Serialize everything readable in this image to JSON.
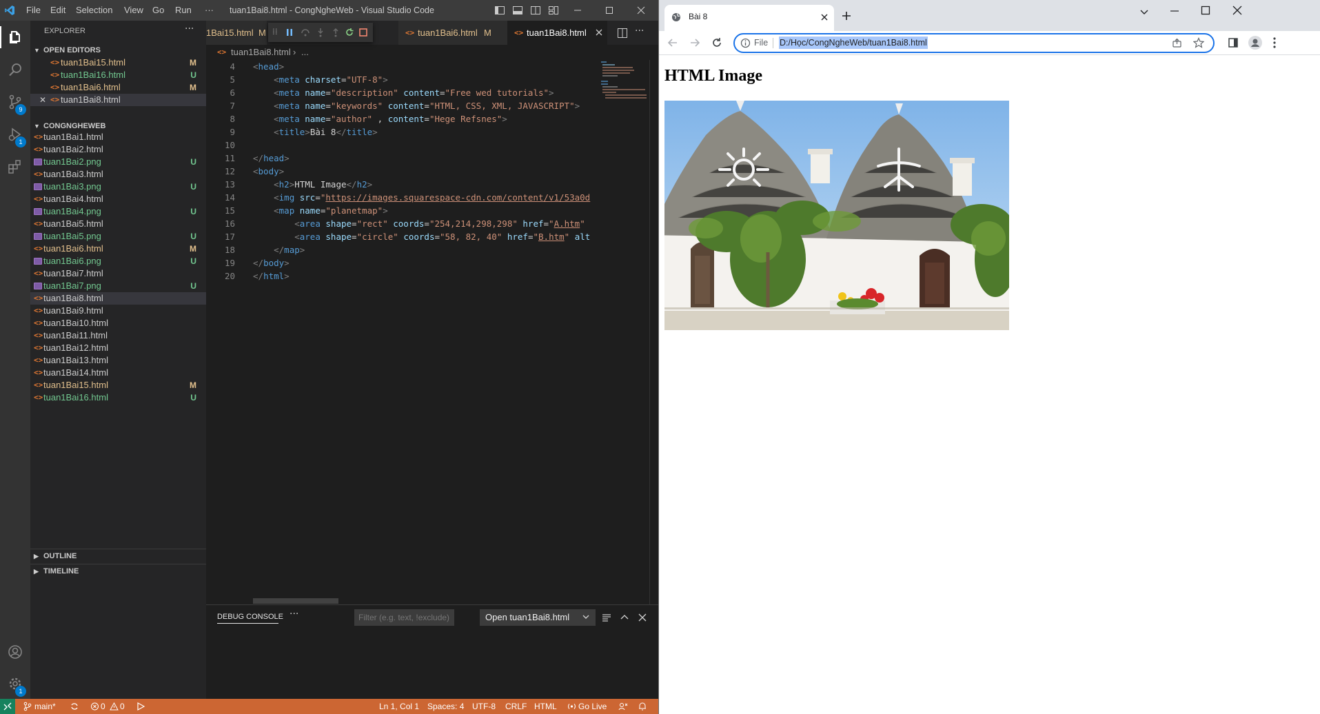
{
  "vscode": {
    "menu": [
      "File",
      "Edit",
      "Selection",
      "View",
      "Go",
      "Run",
      "···"
    ],
    "window_title": "tuan1Bai8.html - CongNgheWeb - Visual Studio Code",
    "badges": {
      "source_control": "9",
      "run_debug": "1",
      "settings": "1"
    },
    "explorer": {
      "title": "EXPLORER",
      "open_editors_label": "OPEN EDITORS",
      "open_editors": [
        {
          "name": "tuan1Bai15.html",
          "status": "M"
        },
        {
          "name": "tuan1Bai16.html",
          "status": "U"
        },
        {
          "name": "tuan1Bai6.html",
          "status": "M"
        },
        {
          "name": "tuan1Bai8.html",
          "status": ""
        }
      ],
      "folder_label": "CONGNGHEWEB",
      "files": [
        {
          "name": "tuan1Bai1.html",
          "type": "html",
          "status": ""
        },
        {
          "name": "tuan1Bai2.html",
          "type": "html",
          "status": ""
        },
        {
          "name": "tuan1Bai2.png",
          "type": "png",
          "status": "U"
        },
        {
          "name": "tuan1Bai3.html",
          "type": "html",
          "status": ""
        },
        {
          "name": "tuan1Bai3.png",
          "type": "png",
          "status": "U"
        },
        {
          "name": "tuan1Bai4.html",
          "type": "html",
          "status": ""
        },
        {
          "name": "tuan1Bai4.png",
          "type": "png",
          "status": "U"
        },
        {
          "name": "tuan1Bai5.html",
          "type": "html",
          "status": ""
        },
        {
          "name": "tuan1Bai5.png",
          "type": "png",
          "status": "U"
        },
        {
          "name": "tuan1Bai6.html",
          "type": "html",
          "status": "M"
        },
        {
          "name": "tuan1Bai6.png",
          "type": "png",
          "status": "U"
        },
        {
          "name": "tuan1Bai7.html",
          "type": "html",
          "status": ""
        },
        {
          "name": "tuan1Bai7.png",
          "type": "png",
          "status": "U"
        },
        {
          "name": "tuan1Bai8.html",
          "type": "html",
          "status": ""
        },
        {
          "name": "tuan1Bai9.html",
          "type": "html",
          "status": ""
        },
        {
          "name": "tuan1Bai10.html",
          "type": "html",
          "status": ""
        },
        {
          "name": "tuan1Bai11.html",
          "type": "html",
          "status": ""
        },
        {
          "name": "tuan1Bai12.html",
          "type": "html",
          "status": ""
        },
        {
          "name": "tuan1Bai13.html",
          "type": "html",
          "status": ""
        },
        {
          "name": "tuan1Bai14.html",
          "type": "html",
          "status": ""
        },
        {
          "name": "tuan1Bai15.html",
          "type": "html",
          "status": "M"
        },
        {
          "name": "tuan1Bai16.html",
          "type": "html",
          "status": "U"
        }
      ],
      "outline_label": "OUTLINE",
      "timeline_label": "TIMELINE"
    },
    "tabs": [
      {
        "label": "1Bai15.html",
        "status": "M"
      },
      {
        "label": "tuan1Bai6.html",
        "status": "M"
      },
      {
        "label": "tuan1Bai8.html",
        "status": ""
      }
    ],
    "breadcrumb": [
      "tuan1Bai8.html",
      "..."
    ],
    "line_numbers": [
      "4",
      "5",
      "6",
      "7",
      "8",
      "9",
      "10",
      "11",
      "12",
      "13",
      "14",
      "15",
      "16",
      "17",
      "18",
      "19",
      "20"
    ],
    "panel": {
      "tab_label": "DEBUG CONSOLE",
      "filter_placeholder": "Filter (e.g. text, !exclude)",
      "select_value": "Open tuan1Bai8.html",
      "prompt": ">"
    },
    "status": {
      "remote": "",
      "branch": "main*",
      "errors": "0",
      "warnings": "0",
      "position": "Ln 1, Col 1",
      "spaces": "Spaces: 4",
      "encoding": "UTF-8",
      "eol": "CRLF",
      "language": "HTML",
      "go_live": "Go Live"
    }
  },
  "browser": {
    "tab_title": "Bài 8",
    "address_scheme": "File",
    "address": "D:/Học/CongNgheWeb/tuan1Bai8.html",
    "page_heading": "HTML Image"
  },
  "colors": {
    "status_bar": "#cc6633",
    "accent": "#007acc",
    "omnibox_border": "#1a73e8"
  }
}
